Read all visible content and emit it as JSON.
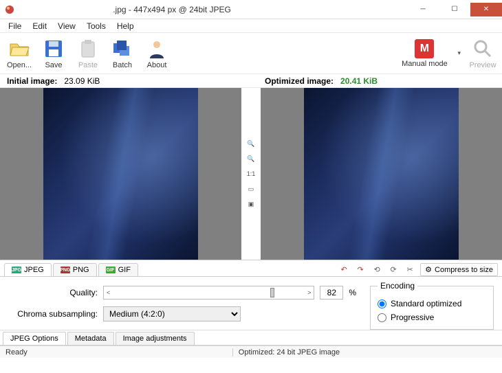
{
  "titlebar": {
    "title": ".jpg - 447x494 px @ 24bit JPEG"
  },
  "menu": {
    "items": [
      "File",
      "Edit",
      "View",
      "Tools",
      "Help"
    ]
  },
  "toolbar": {
    "open": "Open...",
    "save": "Save",
    "paste": "Paste",
    "batch": "Batch",
    "about": "About",
    "mode": "Manual mode",
    "mode_glyph": "M",
    "preview": "Preview"
  },
  "sizes": {
    "initial_label": "Initial image:",
    "initial_value": "23.09 KiB",
    "optimized_label": "Optimized image:",
    "optimized_value": "20.41 KiB"
  },
  "midtools": {
    "zoomin": "🔍",
    "zoomout": "🔍",
    "oneone": "1:1",
    "fit": "▭",
    "both": "▣"
  },
  "formats": {
    "jpeg": "JPEG",
    "png": "PNG",
    "gif": "GIF",
    "compress": "Compress to size"
  },
  "options": {
    "quality_label": "Quality:",
    "quality_value": "82",
    "quality_pct": "%",
    "chroma_label": "Chroma subsampling:",
    "chroma_value": "Medium (4:2:0)",
    "encoding_legend": "Encoding",
    "enc_standard": "Standard optimized",
    "enc_progressive": "Progressive"
  },
  "bottomtabs": {
    "a": "JPEG Options",
    "b": "Metadata",
    "c": "Image adjustments"
  },
  "status": {
    "ready": "Ready",
    "opt": "Optimized: 24 bit JPEG image"
  }
}
